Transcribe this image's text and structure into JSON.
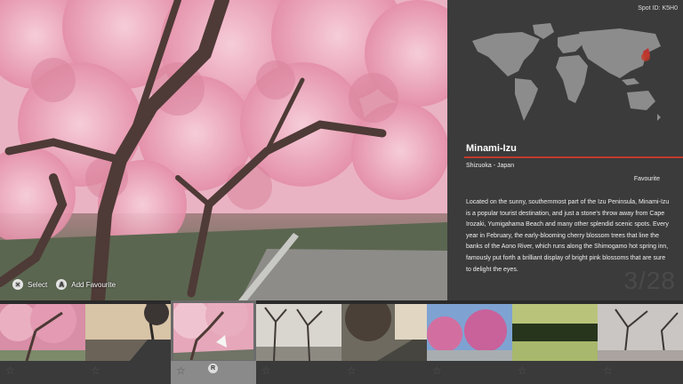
{
  "spot": {
    "id_text": "Spot ID: K5H0",
    "title": "Minami-Izu",
    "subtitle": "Shizuoka - Japan",
    "favourite_label": "Favourite",
    "description": "Located on the sunny, southernmost part of the Izu Peninsula, Minami-Izu is a popular tourist destination, and just a stone's throw away from Cape Irozaki, Yumigahama Beach and many other splendid scenic spots. Every year in February, the early-blooming cherry blossom trees that line the banks of the Aono River, which runs along the Shimogamo hot spring inn, famously put forth a brilliant display of bright pink blossoms that are sure to delight the eyes.",
    "counter": "3/28"
  },
  "controls": {
    "select_button": "✕",
    "select_label": "Select",
    "favourite_button": "A",
    "favourite_label": "Add Favourite"
  },
  "thumbnails": {
    "selected_index": 2,
    "selected_badge": "R",
    "items": [
      {
        "name": "thumb-cherry-1"
      },
      {
        "name": "thumb-sunset-road"
      },
      {
        "name": "thumb-cherry-selected"
      },
      {
        "name": "thumb-bare-trees"
      },
      {
        "name": "thumb-dusk-road"
      },
      {
        "name": "thumb-pink-trees-sky"
      },
      {
        "name": "thumb-green-reflection"
      },
      {
        "name": "thumb-evening-trees"
      }
    ]
  },
  "colors": {
    "accent": "#c0392b",
    "panel": "#3b3b3b",
    "blossom": "#e9a3b8",
    "map_land": "#8c8c8c"
  }
}
